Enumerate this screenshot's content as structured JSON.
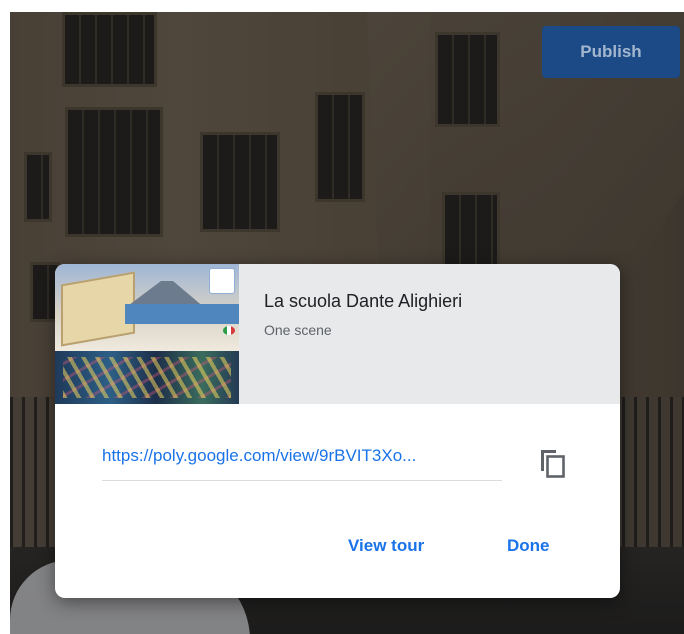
{
  "toolbar": {
    "publish_label": "Publish"
  },
  "dialog": {
    "title": "La scuola Dante Alighieri",
    "subtitle": "One scene",
    "link": "https://poly.google.com/view/9rBVIT3Xo...",
    "copy_icon": "copy-icon",
    "view_tour_label": "View tour",
    "done_label": "Done"
  },
  "colors": {
    "accent": "#1a73e8",
    "publish_button": "#1b4a86",
    "dialog_header": "#e8e9eb"
  }
}
